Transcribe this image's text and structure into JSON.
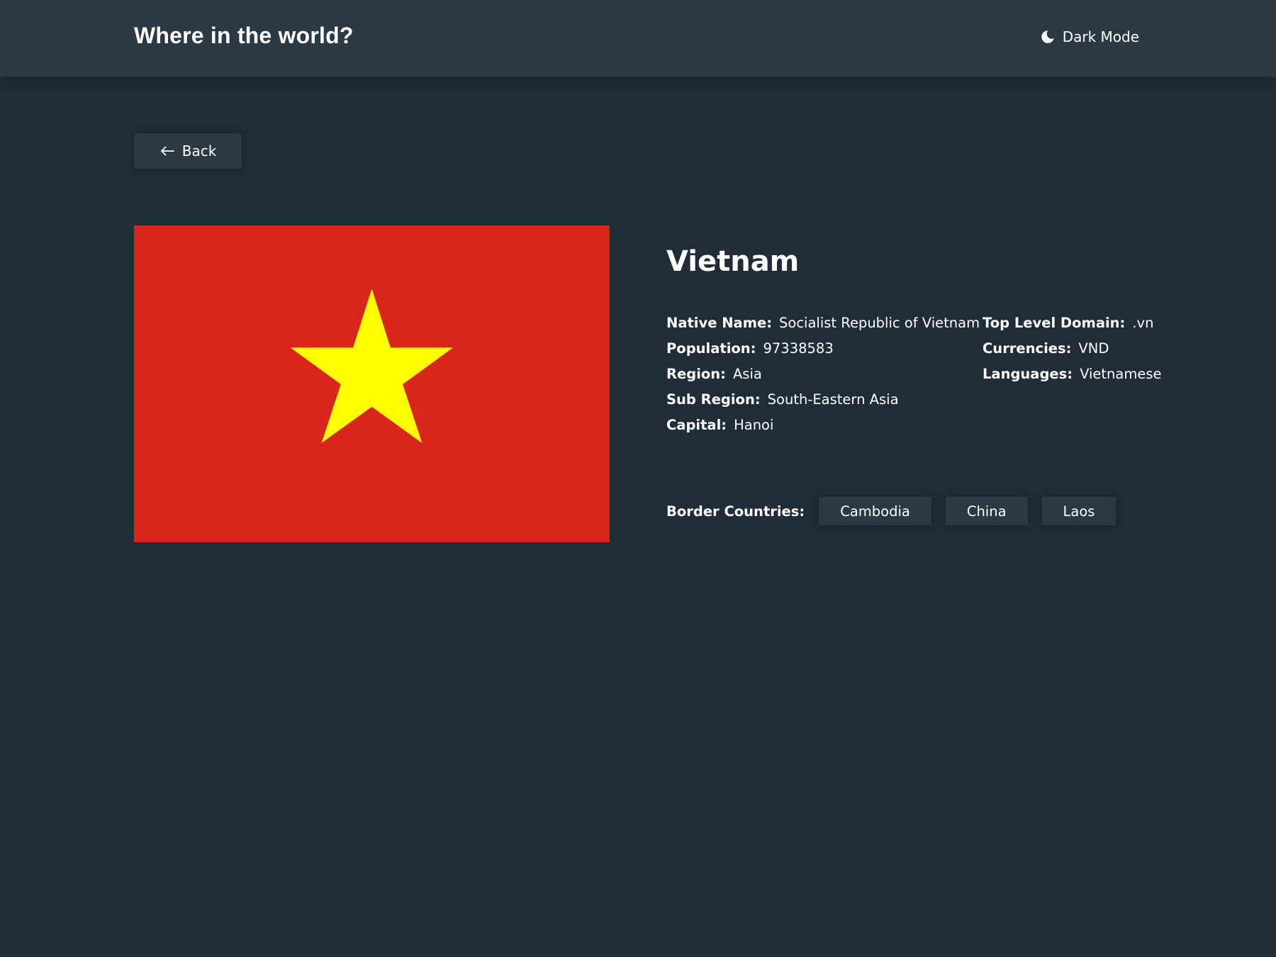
{
  "header": {
    "title": "Where in the world?",
    "theme_toggle_label": "Dark Mode",
    "theme_icon": "moon-icon"
  },
  "back_button": {
    "label": "Back",
    "icon": "arrow-left-icon"
  },
  "country": {
    "name": "Vietnam",
    "flag": {
      "icon": "vietnam-flag",
      "background_color": "#da251d",
      "star_color": "#ffff00"
    },
    "details_left": [
      {
        "label": "Native Name:",
        "value": "Socialist Republic of Vietnam"
      },
      {
        "label": "Population:",
        "value": "97338583"
      },
      {
        "label": "Region:",
        "value": "Asia"
      },
      {
        "label": "Sub Region:",
        "value": "South-Eastern Asia"
      },
      {
        "label": "Capital:",
        "value": "Hanoi"
      }
    ],
    "details_right": [
      {
        "label": "Top Level Domain:",
        "value": ".vn"
      },
      {
        "label": "Currencies:",
        "value": "VND"
      },
      {
        "label": "Languages:",
        "value": "Vietnamese"
      }
    ],
    "border_countries_label": "Border Countries:",
    "border_countries": [
      "Cambodia",
      "China",
      "Laos"
    ]
  },
  "colors": {
    "background": "#202c37",
    "elements": "#2b3945",
    "text": "#ffffff"
  }
}
